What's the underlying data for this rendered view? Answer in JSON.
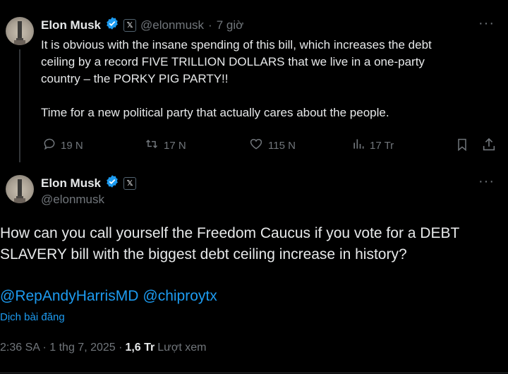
{
  "tweet1": {
    "author_name": "Elon Musk",
    "handle": "@elonmusk",
    "separator": "·",
    "time": "7 giờ",
    "badge_x": "𝕏",
    "text_line1": "It is obvious with the insane spending of this bill, which increases the debt",
    "text_line2": "ceiling by a record FIVE TRILLION DOLLARS that we live in a one-party",
    "text_line3": "country – the PORKY PIG PARTY!!",
    "text_line4": "Time for a new political party that actually cares about the people.",
    "replies": "19 N",
    "reposts": "17 N",
    "likes": "115 N",
    "views": "17 Tr",
    "icons": [
      "reply-icon",
      "repost-icon",
      "like-icon",
      "views-icon",
      "bookmark-icon",
      "share-icon"
    ]
  },
  "tweet2": {
    "author_name": "Elon Musk",
    "handle": "@elonmusk",
    "badge_x": "𝕏",
    "text_line1": "How can you call yourself the Freedom Caucus if you vote for a DEBT",
    "text_line2": "SLAVERY bill with the biggest debt ceiling increase in history?",
    "mention1": "@RepAndyHarrisMD",
    "mention2": "@chiproytx",
    "translate": "Dịch bài đăng",
    "timestamp": "2:36 SA · 1 thg 7, 2025 ·",
    "view_count": "1,6 Tr",
    "view_label": "Lượt xem"
  },
  "colors": {
    "background": "#000000",
    "text": "#e7e9ea",
    "muted": "#71767b",
    "link": "#1d9bf0",
    "verified": "#1d9bf0"
  }
}
